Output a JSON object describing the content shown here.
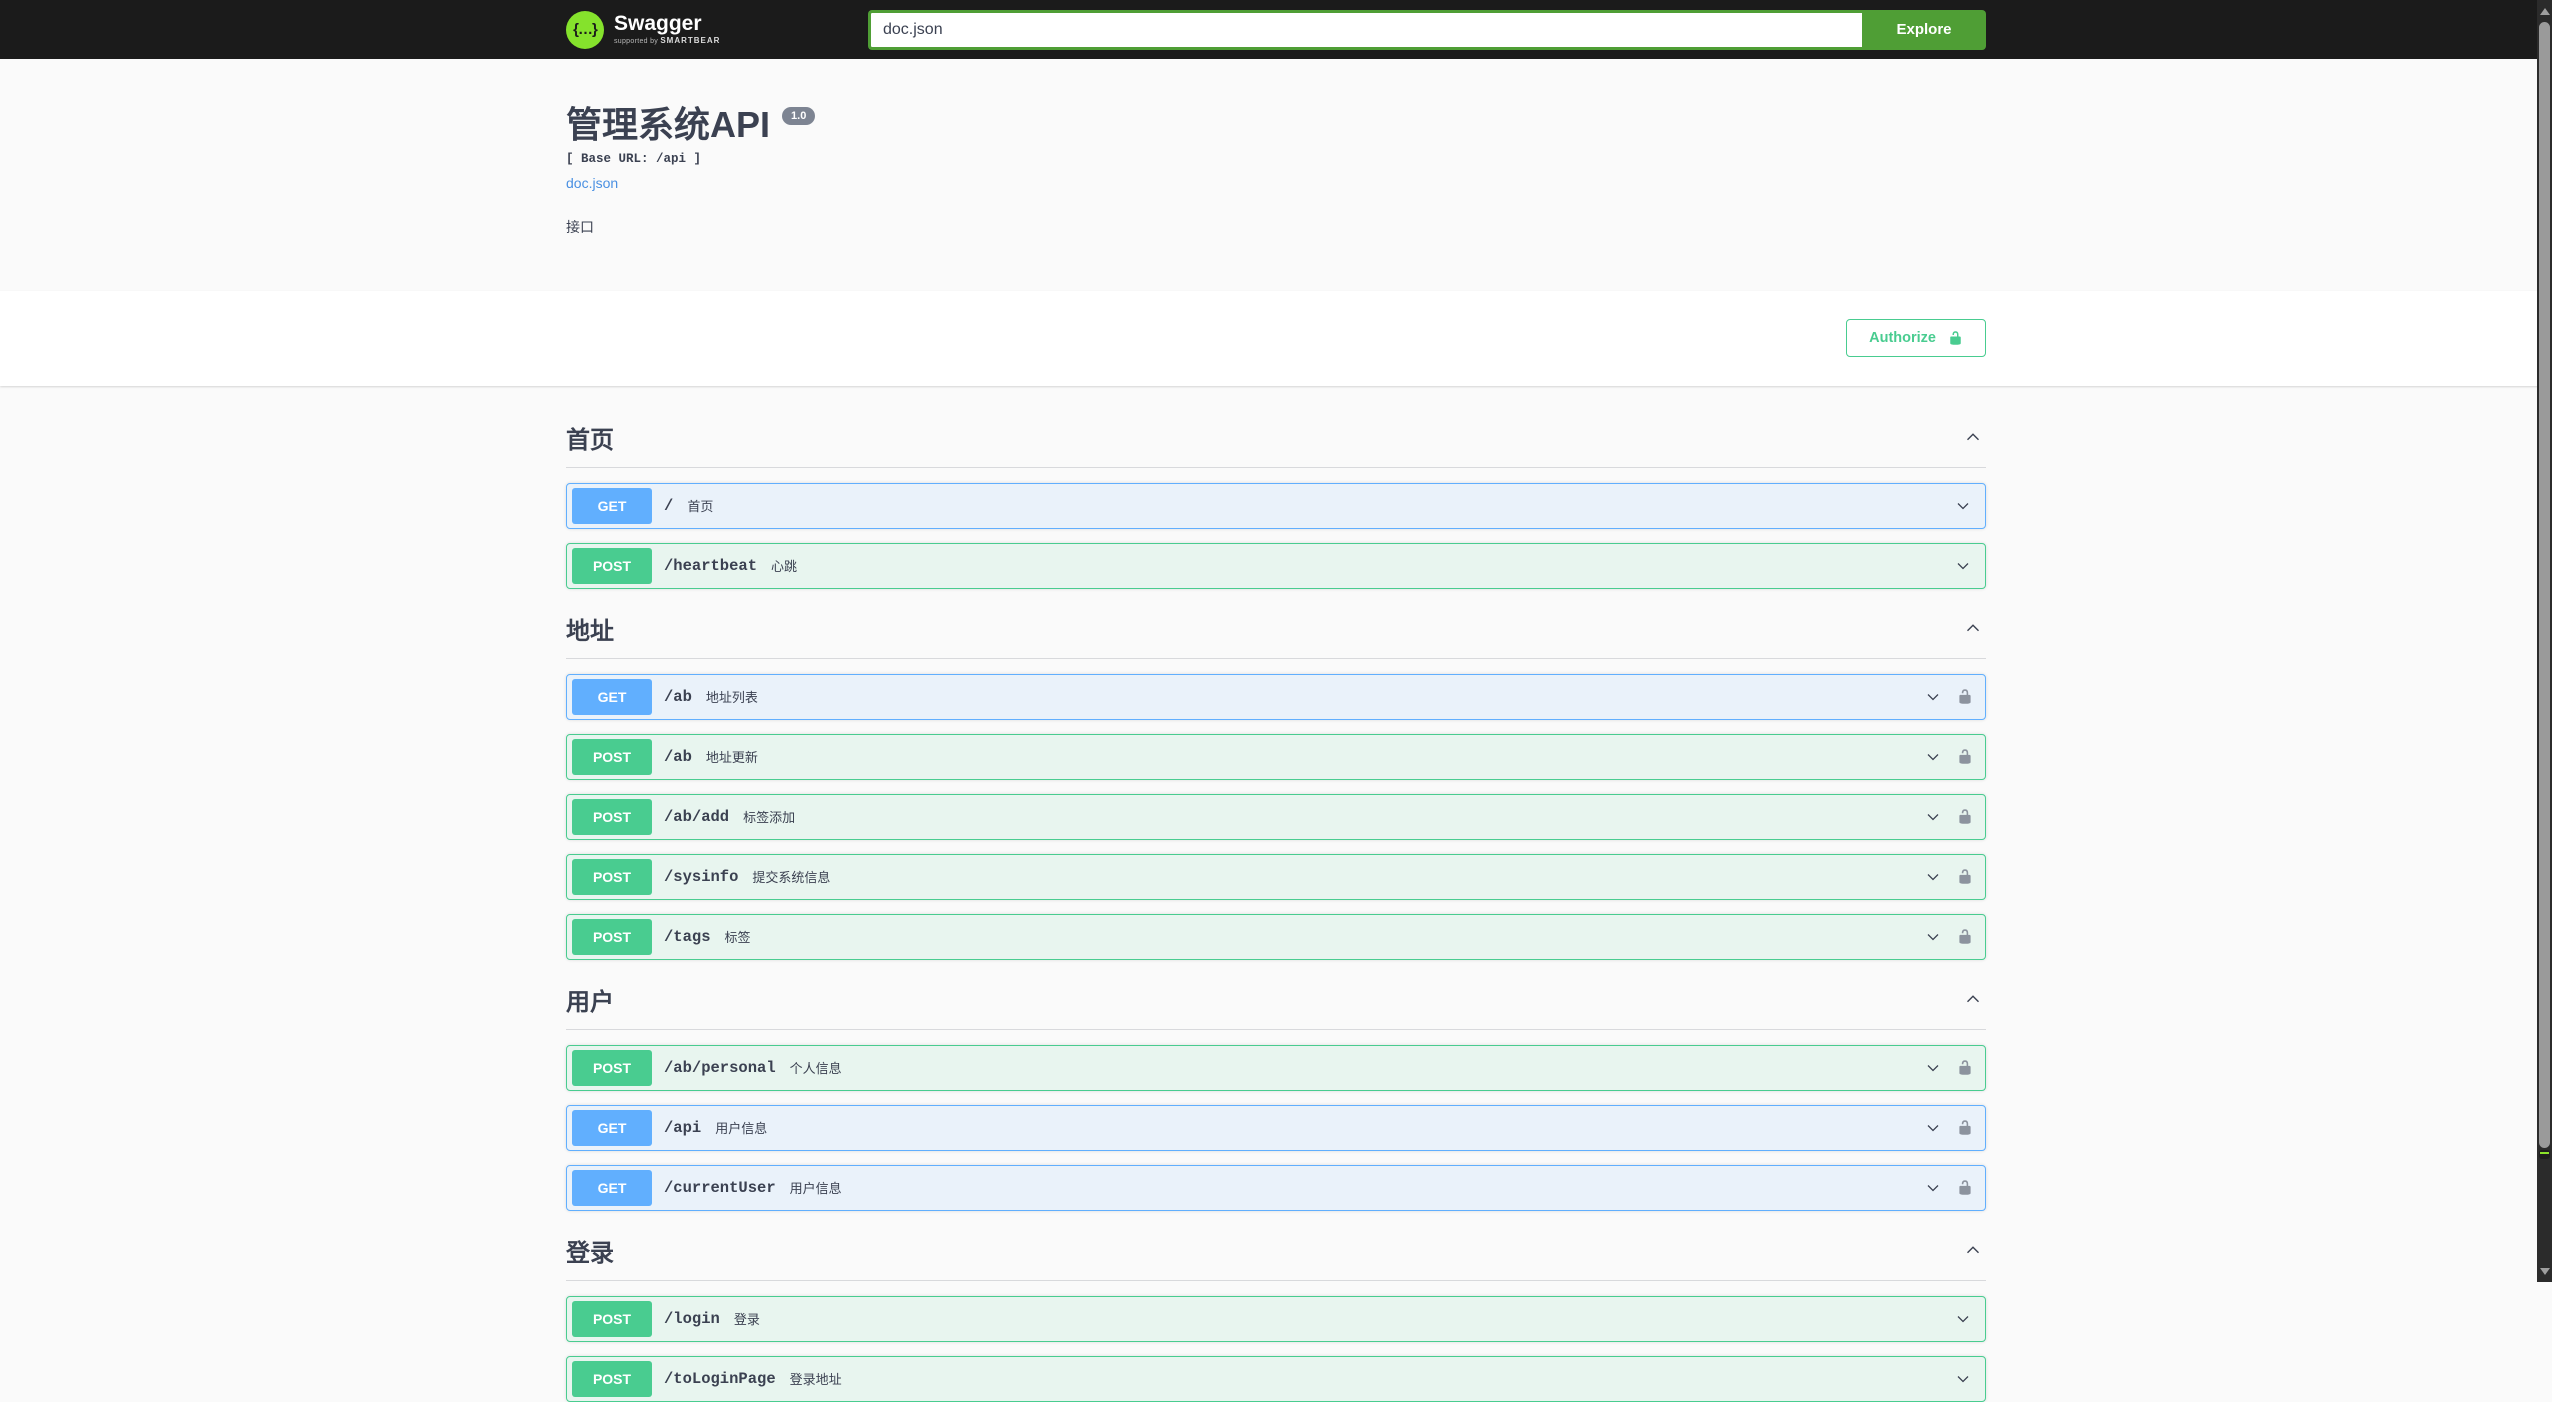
{
  "topbar": {
    "logo_text": "Swagger",
    "logo_sub_prefix": "supported by",
    "logo_sub_brand": "SMARTBEAR",
    "search_value": "doc.json",
    "explore_label": "Explore"
  },
  "info": {
    "title": "管理系统API",
    "version": "1.0",
    "base_url_label": "[ Base URL: /api ]",
    "spec_link": "doc.json",
    "description": "接口"
  },
  "auth": {
    "authorize_label": "Authorize"
  },
  "sections": [
    {
      "title": "首页",
      "expanded": true,
      "operations": [
        {
          "method": "GET",
          "path": "/",
          "summary": "首页",
          "locked": false
        },
        {
          "method": "POST",
          "path": "/heartbeat",
          "summary": "心跳",
          "locked": false
        }
      ]
    },
    {
      "title": "地址",
      "expanded": true,
      "operations": [
        {
          "method": "GET",
          "path": "/ab",
          "summary": "地址列表",
          "locked": true
        },
        {
          "method": "POST",
          "path": "/ab",
          "summary": "地址更新",
          "locked": true
        },
        {
          "method": "POST",
          "path": "/ab/add",
          "summary": "标签添加",
          "locked": true
        },
        {
          "method": "POST",
          "path": "/sysinfo",
          "summary": "提交系统信息",
          "locked": true
        },
        {
          "method": "POST",
          "path": "/tags",
          "summary": "标签",
          "locked": true
        }
      ]
    },
    {
      "title": "用户",
      "expanded": true,
      "operations": [
        {
          "method": "POST",
          "path": "/ab/personal",
          "summary": "个人信息",
          "locked": true
        },
        {
          "method": "GET",
          "path": "/api",
          "summary": "用户信息",
          "locked": true
        },
        {
          "method": "GET",
          "path": "/currentUser",
          "summary": "用户信息",
          "locked": true
        }
      ]
    },
    {
      "title": "登录",
      "expanded": true,
      "operations": [
        {
          "method": "POST",
          "path": "/login",
          "summary": "登录",
          "locked": false
        },
        {
          "method": "POST",
          "path": "/toLoginPage",
          "summary": "登录地址",
          "locked": false
        }
      ]
    }
  ],
  "icons": {
    "swagger_logo_braces": "{…}",
    "section_collapse": "chevron-up",
    "operation_expand": "chevron-down",
    "authorize_lock": "unlock-open",
    "operation_lock": "unlock-open",
    "scrollbar_up": "▲",
    "scrollbar_down": "▼"
  },
  "colors": {
    "topbar_bg": "#1b1b1b",
    "logo_green": "#85e22c",
    "accent_green": "#4f9e35",
    "authorize_green": "#49cc90",
    "get": "#61affe",
    "post": "#49cc90",
    "get_bg": "#eaf2fa",
    "post_bg": "#e8f5ef",
    "link_blue": "#4a90e2",
    "text": "#3b4151",
    "badge_gray": "#7d8492",
    "lock_gray": "#8c939e"
  }
}
